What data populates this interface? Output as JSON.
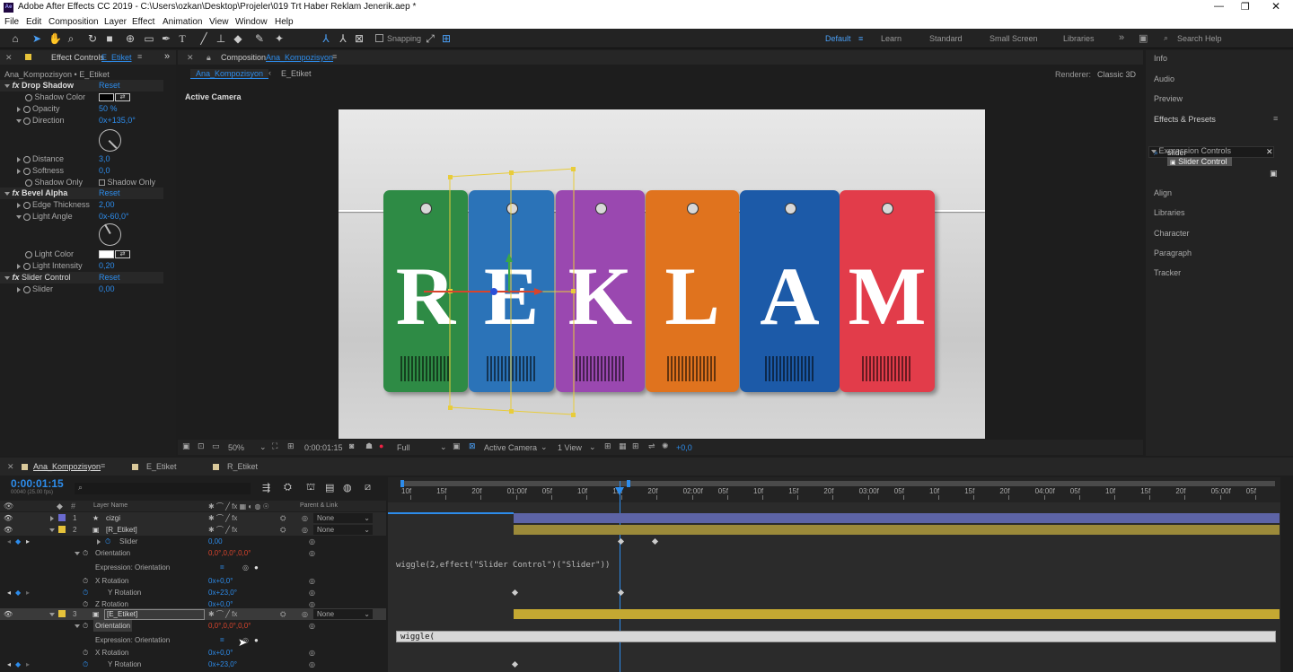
{
  "window": {
    "title": "Adobe After Effects CC 2019 - C:\\Users\\ozkan\\Desktop\\Projeler\\019 Trt Haber Reklam Jenerik.aep *"
  },
  "menu": [
    "File",
    "Edit",
    "Composition",
    "Layer",
    "Effect",
    "Animation",
    "View",
    "Window",
    "Help"
  ],
  "toolbar": {
    "snapping": "Snapping",
    "workspaces": [
      "Default",
      "Learn",
      "Standard",
      "Small Screen",
      "Libraries"
    ],
    "search_placeholder": "Search Help"
  },
  "effect_controls": {
    "tab_prefix": "Effect Controls",
    "tab_layer": "E_Etiket",
    "breadcrumb": "Ana_Kompozisyon • E_Etiket",
    "drop_shadow": {
      "name": "Drop Shadow",
      "reset": "Reset",
      "shadow_color": "Shadow Color",
      "opacity": "Opacity",
      "opacity_val": "50 %",
      "direction": "Direction",
      "direction_val": "0x+135,0°",
      "distance": "Distance",
      "distance_val": "3,0",
      "softness": "Softness",
      "softness_val": "0,0",
      "shadow_only": "Shadow Only",
      "shadow_only_cb": "Shadow Only"
    },
    "bevel_alpha": {
      "name": "Bevel Alpha",
      "reset": "Reset",
      "edge": "Edge Thickness",
      "edge_val": "2,00",
      "angle": "Light Angle",
      "angle_val": "0x-60,0°",
      "color": "Light Color",
      "intensity": "Light Intensity",
      "intensity_val": "0,20"
    },
    "slider_control": {
      "name": "Slider Control",
      "reset": "Reset",
      "slider": "Slider",
      "slider_val": "0,00"
    }
  },
  "composition": {
    "tab_prefix": "Composition",
    "tab_name": "Ana_Kompozisyon",
    "flow_tabs": [
      "Ana_Kompozisyon",
      "E_Etiket"
    ],
    "renderer_label": "Renderer:",
    "renderer": "Classic 3D",
    "active_camera": "Active Camera",
    "letters": [
      "R",
      "E",
      "K",
      "L",
      "A",
      "M"
    ],
    "tag_colors": [
      "#2e8b45",
      "#2b73b8",
      "#9a48b0",
      "#e0731e",
      "#1c5aa8",
      "#e23c4a"
    ],
    "footer": {
      "zoom": "50%",
      "time": "0:00:01:15",
      "resolution": "Full",
      "camera": "Active Camera",
      "views": "1 View",
      "exposure": "+0,0"
    }
  },
  "right_panel": {
    "items": [
      "Info",
      "Audio",
      "Preview",
      "Effects & Presets",
      "Align",
      "Libraries",
      "Character",
      "Paragraph",
      "Tracker"
    ],
    "search_value": "slider",
    "category": "Expression Controls",
    "result": "Slider Control"
  },
  "timeline": {
    "tabs": [
      "Ana_Kompozisyon",
      "E_Etiket",
      "R_Etiket"
    ],
    "timecode": "0:00:01:15",
    "frame_info": "00040 (25.00 fps)",
    "col_layer": "Layer Name",
    "col_parent": "Parent & Link",
    "ticks": [
      "10f",
      "15f",
      "20f",
      "01:00f",
      "05f",
      "10f",
      "15f",
      "20f",
      "02:00f",
      "05f",
      "10f",
      "15f",
      "20f",
      "03:00f",
      "05f",
      "10f",
      "15f",
      "20f",
      "04:00f",
      "05f",
      "10f",
      "15f",
      "20f",
      "05:00f",
      "05f"
    ],
    "layers": {
      "l1": {
        "num": "1",
        "name": "cizgi",
        "parent": "None"
      },
      "l2": {
        "num": "2",
        "name": "[R_Etiket]",
        "parent": "None"
      },
      "slider": {
        "name": "Slider",
        "val": "0,00"
      },
      "orient": {
        "name": "Orientation",
        "val": "0,0°,0,0°,0,0°"
      },
      "expr_label": "Expression: Orientation",
      "xrot": {
        "name": "X Rotation",
        "val": "0x+0,0°"
      },
      "yrot": {
        "name": "Y Rotation",
        "val": "0x+23,0°"
      },
      "zrot": {
        "name": "Z Rotation",
        "val": "0x+0,0°"
      },
      "l3": {
        "num": "3",
        "name": "[E_Etiket]",
        "parent": "None"
      },
      "orient3": {
        "name": "Orientation",
        "val": "0,0°,0,0°,0,0°"
      },
      "expr_label3": "Expression: Orientation",
      "xrot3": {
        "name": "X Rotation",
        "val": "0x+0,0°"
      },
      "yrot3": {
        "name": "Y Rotation",
        "val": "0x+23,0°"
      }
    },
    "expression1": "wiggle(2,effect(\"Slider Control\")(\"Slider\"))",
    "expression2": "wiggle("
  }
}
